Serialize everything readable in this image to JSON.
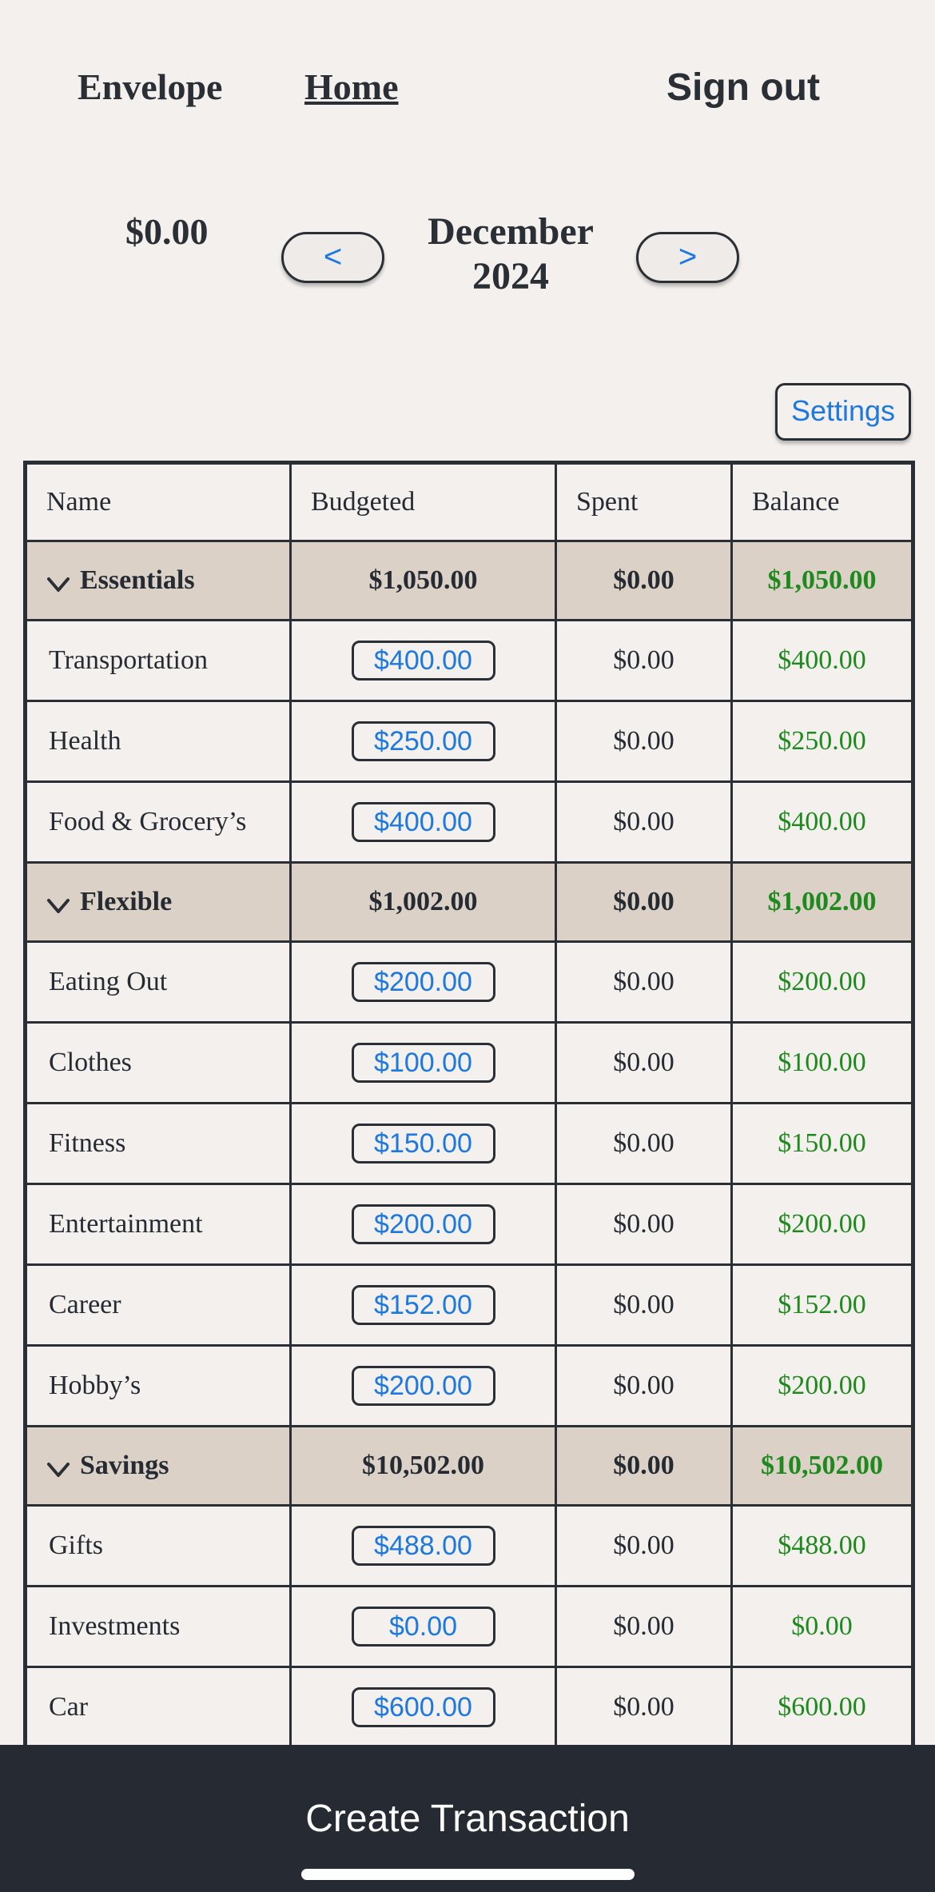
{
  "nav": {
    "brand": "Envelope",
    "home": "Home",
    "sign_out": "Sign out"
  },
  "month_bar": {
    "total": "$0.00",
    "prev_label": "<",
    "next_label": ">",
    "month": "December",
    "year": "2024"
  },
  "settings_label": "Settings",
  "table": {
    "headers": [
      "Name",
      "Budgeted",
      "Spent",
      "Balance"
    ],
    "groups": [
      {
        "name": "Essentials",
        "budgeted": "$1,050.00",
        "spent": "$0.00",
        "balance": "$1,050.00",
        "rows": [
          {
            "name": "Transportation",
            "budgeted": "$400.00",
            "spent": "$0.00",
            "balance": "$400.00"
          },
          {
            "name": "Health",
            "budgeted": "$250.00",
            "spent": "$0.00",
            "balance": "$250.00"
          },
          {
            "name": "Food & Grocery’s",
            "budgeted": "$400.00",
            "spent": "$0.00",
            "balance": "$400.00"
          }
        ]
      },
      {
        "name": "Flexible",
        "budgeted": "$1,002.00",
        "spent": "$0.00",
        "balance": "$1,002.00",
        "rows": [
          {
            "name": "Eating Out",
            "budgeted": "$200.00",
            "spent": "$0.00",
            "balance": "$200.00"
          },
          {
            "name": "Clothes",
            "budgeted": "$100.00",
            "spent": "$0.00",
            "balance": "$100.00"
          },
          {
            "name": "Fitness",
            "budgeted": "$150.00",
            "spent": "$0.00",
            "balance": "$150.00"
          },
          {
            "name": "Entertainment",
            "budgeted": "$200.00",
            "spent": "$0.00",
            "balance": "$200.00"
          },
          {
            "name": "Career",
            "budgeted": "$152.00",
            "spent": "$0.00",
            "balance": "$152.00"
          },
          {
            "name": "Hobby’s",
            "budgeted": "$200.00",
            "spent": "$0.00",
            "balance": "$200.00"
          }
        ]
      },
      {
        "name": "Savings",
        "budgeted": "$10,502.00",
        "spent": "$0.00",
        "balance": "$10,502.00",
        "rows": [
          {
            "name": "Gifts",
            "budgeted": "$488.00",
            "spent": "$0.00",
            "balance": "$488.00"
          },
          {
            "name": "Investments",
            "budgeted": "$0.00",
            "spent": "$0.00",
            "balance": "$0.00"
          },
          {
            "name": "Car",
            "budgeted": "$600.00",
            "spent": "$0.00",
            "balance": "$600.00"
          }
        ]
      }
    ]
  },
  "footer": {
    "create_label": "Create Transaction"
  },
  "icons": {
    "group_toggle": "chevron-down-icon"
  },
  "colors": {
    "background": "#f3f0ed",
    "dark": "#262b33",
    "accent_blue": "#1d78e0",
    "balance_green": "#1e8a1e",
    "group_row": "#dbd1c6"
  }
}
